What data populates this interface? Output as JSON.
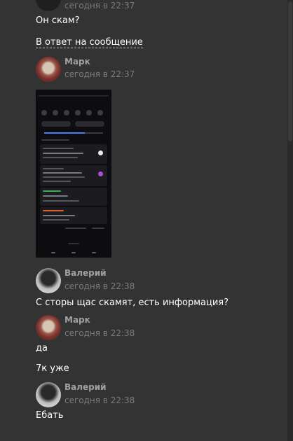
{
  "messages": [
    {
      "time": "сегодня в 22:37",
      "text": "Он скам?"
    },
    {
      "reply_label": "В ответ на сообщение"
    },
    {
      "author": "Марк",
      "time": "сегодня в 22:37"
    },
    {
      "author": "Валерий",
      "time": "сегодня в 22:38",
      "text": "С сторы щас скамят, есть информация?"
    },
    {
      "author": "Марк",
      "time": "сегодня в 22:38",
      "text": "да"
    },
    {
      "text": "7к уже"
    },
    {
      "author": "Валерий",
      "time": "сегодня в 22:38",
      "text": "Ебать"
    }
  ]
}
